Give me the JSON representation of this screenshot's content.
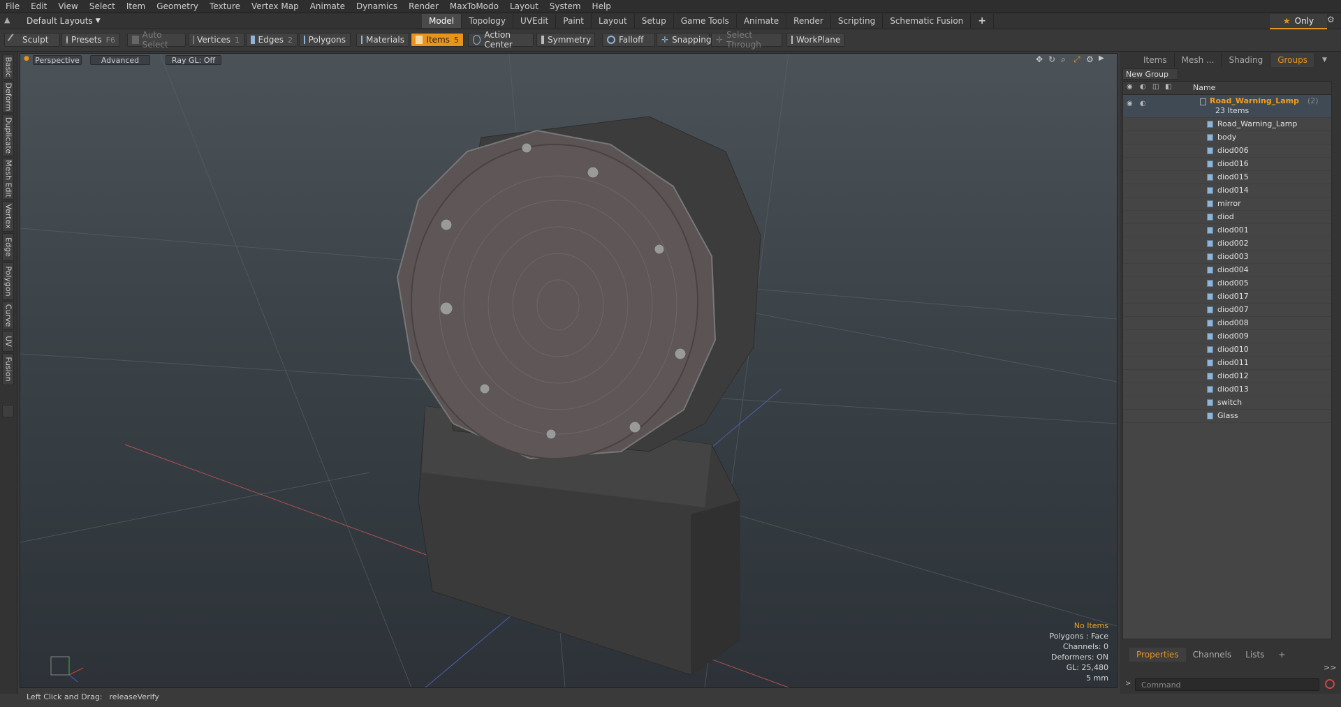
{
  "menu": [
    "File",
    "Edit",
    "View",
    "Select",
    "Item",
    "Geometry",
    "Texture",
    "Vertex Map",
    "Animate",
    "Dynamics",
    "Render",
    "MaxToModo",
    "Layout",
    "System",
    "Help"
  ],
  "layout_select": "Default Layouts",
  "tabs": [
    "Model",
    "Topology",
    "UVEdit",
    "Paint",
    "Layout",
    "Setup",
    "Game Tools",
    "Animate",
    "Render",
    "Scripting",
    "Schematic Fusion"
  ],
  "only_label": "Only",
  "toolbar": {
    "sculpt": "Sculpt",
    "presets": "Presets",
    "presets_key": "F6",
    "auto_select": "Auto Select",
    "vertices": "Vertices",
    "vertices_key": "1",
    "edges": "Edges",
    "edges_key": "2",
    "polygons": "Polygons",
    "materials": "Materials",
    "items": "Items",
    "items_key": "5",
    "action_center": "Action Center",
    "symmetry": "Symmetry",
    "falloff": "Falloff",
    "snapping": "Snapping",
    "select_through": "Select Through",
    "workplane": "WorkPlane"
  },
  "left_tabs": [
    "Basic",
    "Deform",
    "Duplicate",
    "Mesh Edit",
    "Vertex",
    "Edge",
    "Polygon",
    "Curve",
    "UV",
    "Fusion"
  ],
  "viewport": {
    "view": "Perspective",
    "shading": "Advanced",
    "raygl": "Ray GL: Off",
    "info": {
      "no_items": "No Items",
      "polygons": "Polygons : Face",
      "channels": "Channels: 0",
      "deformers": "Deformers: ON",
      "gl": "GL: 25,480",
      "scale": "5 mm"
    }
  },
  "right_panel": {
    "tabs": [
      "Items",
      "Mesh ...",
      "Shading",
      "Groups"
    ],
    "new_group": "New Group",
    "name_header": "Name",
    "group_name": "Road_Warning_Lamp",
    "group_count": "(2)",
    "group_items": "23 Items",
    "items": [
      "Road_Warning_Lamp",
      "body",
      "diod006",
      "diod016",
      "diod015",
      "diod014",
      "mirror",
      "diod",
      "diod001",
      "diod002",
      "diod003",
      "diod004",
      "diod005",
      "diod017",
      "diod007",
      "diod008",
      "diod009",
      "diod010",
      "diod011",
      "diod012",
      "diod013",
      "switch",
      "Glass"
    ],
    "bottom_tabs": [
      "Properties",
      "Channels",
      "Lists"
    ],
    "command_placeholder": "Command"
  },
  "status": {
    "left": "Left Click and Drag:",
    "right": "releaseVerify"
  },
  "colors": {
    "accent": "#e8941a",
    "group_name": "#f0a020"
  }
}
